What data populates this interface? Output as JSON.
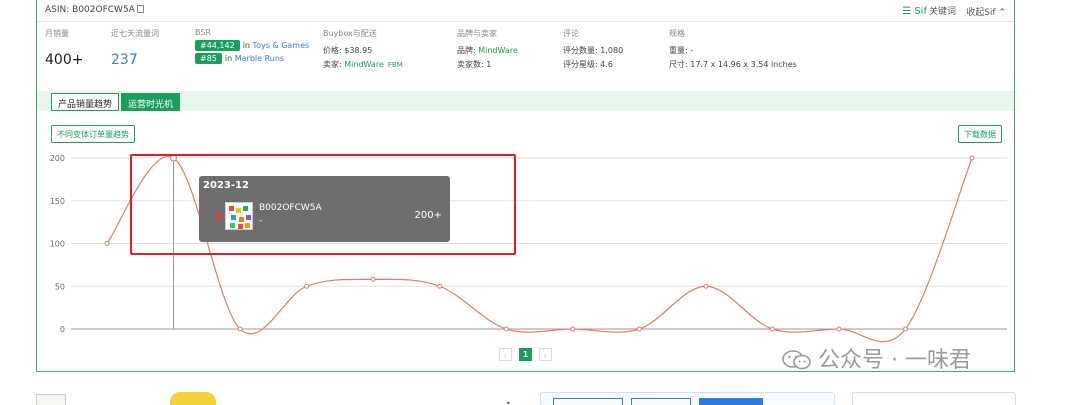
{
  "header": {
    "asin_label": "ASIN: B002OFCW5A",
    "sif_brand": "☰ Sif",
    "sif_keyword": "关键词",
    "collapse_label": "收起Sif ⌃"
  },
  "stats": {
    "monthly_sales": {
      "label": "月销量",
      "value": "400+"
    },
    "views_7d": {
      "label": "近七天流量词",
      "value": "237"
    },
    "bsr": {
      "label": "BSR",
      "rank1": "#44,142",
      "rank1_in": "in",
      "rank1_cat": "Toys & Games",
      "rank2": "#85",
      "rank2_in": "in",
      "rank2_cat": "Marble Runs"
    },
    "buybox": {
      "label": "Buybox与配送",
      "price_key": "价格:",
      "price_val": "$38.95",
      "seller_key": "卖家:",
      "seller_val": "MindWare",
      "fulfillment": "FBM"
    },
    "brand": {
      "label": "品牌与卖家",
      "brand_key": "品牌:",
      "brand_val": "MindWare",
      "sellers_key": "卖家数:",
      "sellers_val": "1"
    },
    "reviews": {
      "label": "评论",
      "count_key": "评分数量:",
      "count_val": "1,080",
      "rating_key": "评分星级:",
      "rating_val": "4.6"
    },
    "spec": {
      "label": "规格",
      "weight_key": "重量:",
      "weight_val": "-",
      "size_key": "尺寸:",
      "size_val": "17.7 x 14.96 x 3.54 inches"
    }
  },
  "tabs": [
    {
      "label": "产品销量趋势",
      "active": false
    },
    {
      "label": "运营时光机",
      "active": true
    }
  ],
  "buttons": {
    "variant_trend": "不同变体订单量趋势",
    "download": "下载数据"
  },
  "tooltip": {
    "date": "2023-12",
    "asin": "B002OFCW5A",
    "sub": "-",
    "value": "200+"
  },
  "pagination": {
    "prev": "‹",
    "current": "1",
    "next": "›"
  },
  "watermark": "公众号 · 一味君",
  "colors": {
    "accent": "#1a9e5c",
    "line": "#e07a70",
    "highlight": "#e02020"
  },
  "chart_data": {
    "type": "line",
    "title": "",
    "xlabel": "",
    "ylabel": "",
    "ylim": [
      0,
      200
    ],
    "yticks": [
      0,
      50,
      100,
      150,
      200
    ],
    "grid": true,
    "series": [
      {
        "values": [
          100,
          200,
          0,
          50,
          58,
          50,
          0,
          0,
          0,
          50,
          0,
          0,
          0,
          200
        ]
      }
    ],
    "highlight_index": 1
  }
}
